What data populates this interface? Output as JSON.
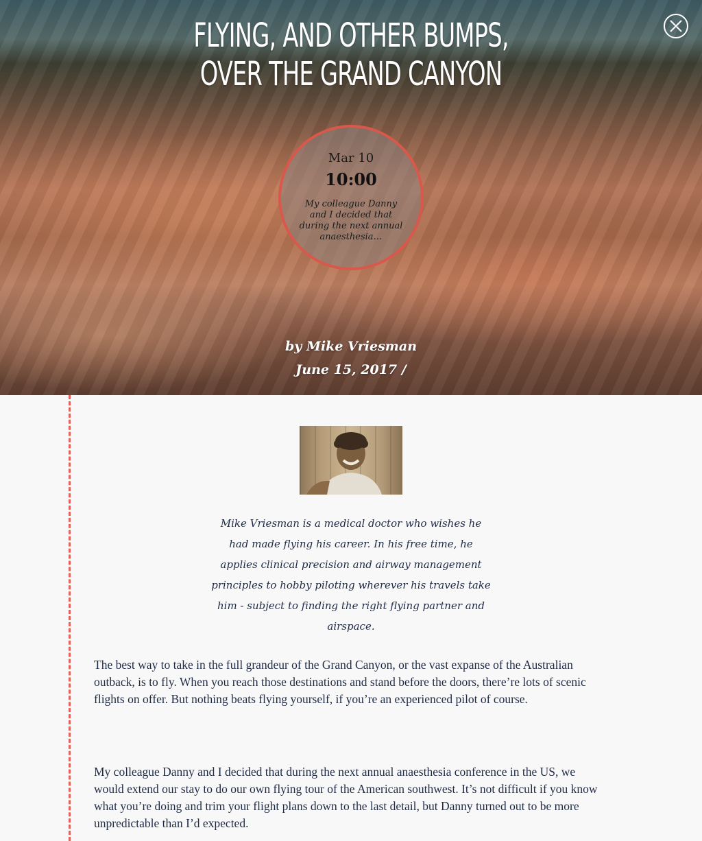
{
  "hero": {
    "title": "FLYING, AND OTHER BUMPS, OVER THE GRAND CANYON",
    "close_icon": "close-icon"
  },
  "event": {
    "date": "Mar 10",
    "time": "10:00",
    "excerpt": "My colleague Danny and I decided that during the next annual anaesthesia…"
  },
  "byline": {
    "author": "by Mike Vriesman",
    "date": "June 15, 2017 /"
  },
  "author": {
    "bio": "Mike Vriesman is a medical doctor who wishes he had made flying his career. In his free time, he applies clinical precision and airway management principles to hobby piloting wherever his travels take him - subject to finding the right flying partner and airspace."
  },
  "article": {
    "paragraphs": [
      "The best way to take in the full grandeur of the Grand Canyon, or the vast expanse of the Australian outback, is to fly. When you reach those destinations and stand before the doors, there’re lots of scenic flights on offer. But nothing beats flying yourself, if you’re an experienced pilot of course.",
      "My colleague Danny and I decided that during the next annual anaesthesia conference in the US, we would extend our stay to do our own flying tour of the American southwest. It’s not difficult if you know what you’re doing and trim your flight plans down to the last detail, but Danny turned out to be more unpredictable than I’d expected."
    ]
  },
  "colors": {
    "accent": "#d9584c",
    "text": "#1f2a44",
    "page_bg": "#f8f8f8"
  }
}
